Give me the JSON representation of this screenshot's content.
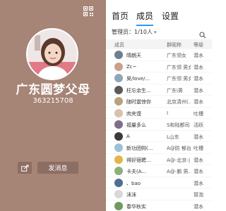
{
  "profile": {
    "group_name": "广东圆梦父母",
    "group_id": "363215708",
    "send_message_label": "发消息",
    "qr_icon": "qr-code-icon",
    "share_icon": "share-icon",
    "accent_color": "#a68476"
  },
  "tabs": [
    {
      "label": "首页",
      "active": false
    },
    {
      "label": "成员",
      "active": true
    },
    {
      "label": "设置",
      "active": false
    }
  ],
  "admin_filter": {
    "label": "管理员：1/10人",
    "chevron_icon": "chevron-down-icon",
    "search_icon": "search-icon"
  },
  "columns": {
    "member": "成员",
    "group_card": "群昵称",
    "level": "等级"
  },
  "members": [
    {
      "name": "晴朗天",
      "card": "广东领女",
      "level": "潜水",
      "color": "#6b7f91"
    },
    {
      "name": "Zc~",
      "card": "广东领 男女",
      "level": "潜水",
      "color": "#c99f8e"
    },
    {
      "name": "昊/love/...",
      "card": "广东领 男女...",
      "level": "潜水",
      "color": "#8fa5b8"
    },
    {
      "name": "枉忘余生...",
      "card": "广东i男",
      "level": "潜水",
      "color": "#5a5a5a"
    },
    {
      "name": "随时震惊你",
      "card": "北京清州(...",
      "level": "潜水",
      "color": "#b9a27a"
    },
    {
      "name": "肉夹馍",
      "card": "I",
      "level": "吐槽",
      "color": "#d9c2ad"
    },
    {
      "name": "福量多么",
      "card": "S和陆都司",
      "level": "活跃",
      "color": "#7d6f8c"
    },
    {
      "name": "A",
      "card": "L山东",
      "level": "潜水",
      "color": "#3a3a3a"
    },
    {
      "name": "新功团购(...",
      "card": "A@防 郁台",
      "level": "吐槽",
      "color": "#9ac2d6"
    },
    {
      "name": "得好宿聘...",
      "card": "A@-北京-|...",
      "level": "潜水",
      "color": "#e3b44a"
    },
    {
      "name": "卡夫(A...",
      "card": "A@-鹏 男...",
      "level": "潜水",
      "color": "#8bb07a"
    },
    {
      "name": "、bao",
      "card": "",
      "level": "潜水",
      "color": "#4f6f8f"
    },
    {
      "name": "沫沫",
      "card": "",
      "level": "冒泡",
      "color": "#d8d8d8"
    },
    {
      "name": "春华秋实",
      "card": "",
      "level": "潜水",
      "color": "#6f9a5c"
    }
  ]
}
